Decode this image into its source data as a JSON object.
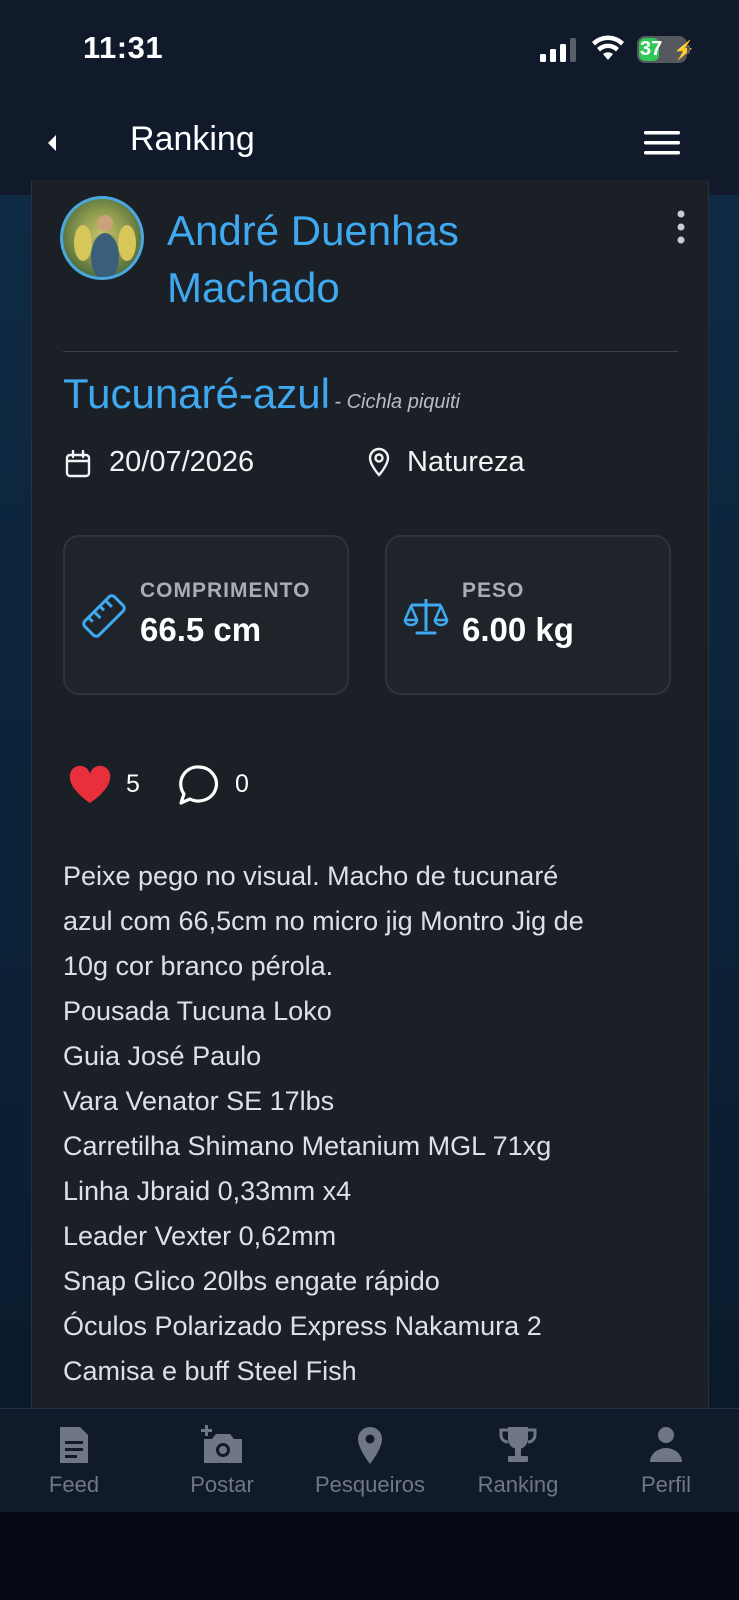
{
  "status_bar": {
    "time": "11:31",
    "battery": "37"
  },
  "header": {
    "title": "Ranking"
  },
  "post": {
    "user_name": "André Duenhas Machado",
    "species_common": "Tucunaré-azul",
    "species_scientific": "- Cichla piquiti",
    "date": "20/07/2026",
    "location": "Natureza",
    "stats": {
      "length_label": "COMPRIMENTO",
      "length_value": "66.5 cm",
      "weight_label": "PESO",
      "weight_value": "6.00 kg"
    },
    "likes": "5",
    "comments": "0",
    "description": [
      "Peixe pego no visual. Macho de tucunaré",
      "azul com 66,5cm no micro jig Montro Jig de",
      "10g cor branco pérola.",
      "Pousada Tucuna Loko",
      "Guia José Paulo",
      "Vara Venator SE 17lbs",
      "Carretilha Shimano Metanium MGL 71xg",
      "Linha Jbraid 0,33mm x4",
      "Leader Vexter 0,62mm",
      "Snap Glico 20lbs engate rápido",
      "Óculos Polarizado Express Nakamura 2",
      "Camisa e buff Steel Fish"
    ]
  },
  "bottom_nav": [
    {
      "label": "Feed",
      "icon": "feed-icon"
    },
    {
      "label": "Postar",
      "icon": "add-photo-icon"
    },
    {
      "label": "Pesqueiros",
      "icon": "map-pin-icon"
    },
    {
      "label": "Ranking",
      "icon": "trophy-icon"
    },
    {
      "label": "Perfil",
      "icon": "profile-icon"
    }
  ],
  "colors": {
    "accent": "#3fa9f0",
    "like": "#e8303c",
    "background": "#1b1f26"
  }
}
